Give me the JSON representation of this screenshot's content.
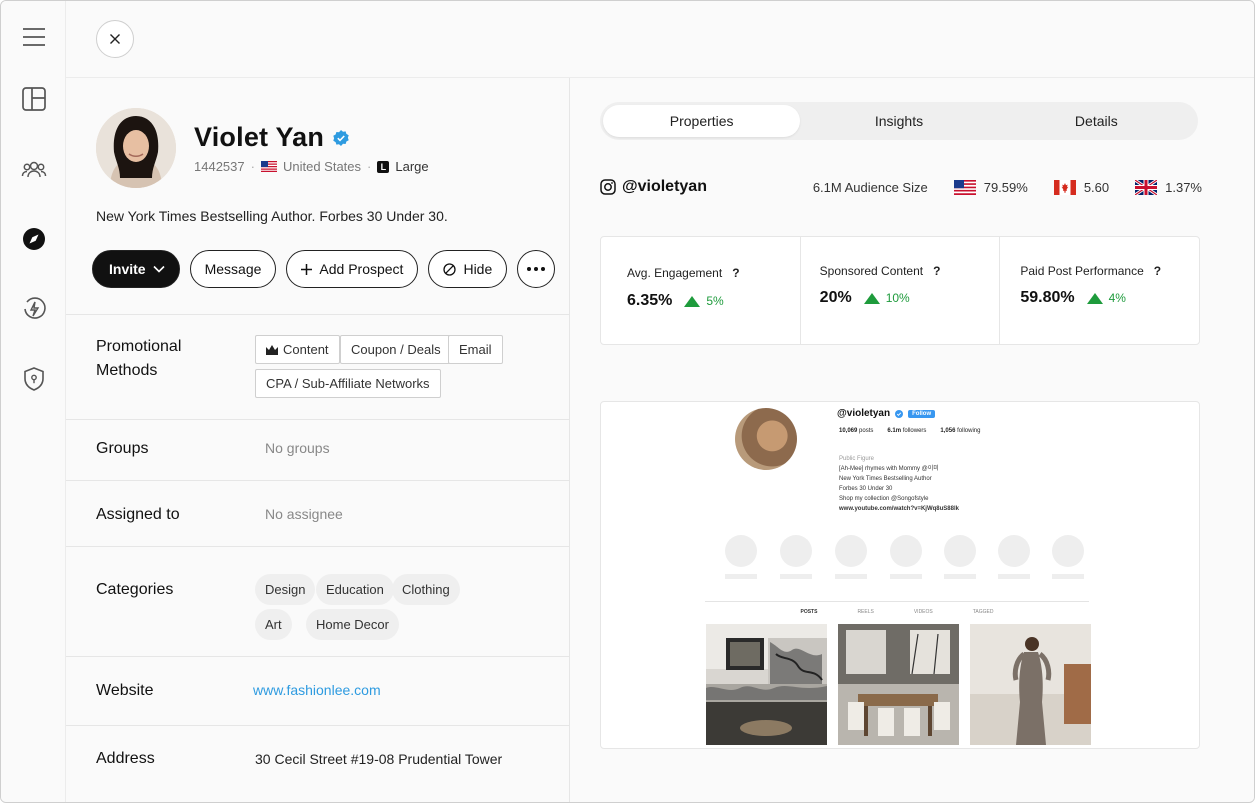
{
  "profile": {
    "name": "Violet Yan",
    "id": "1442537",
    "country": "United States",
    "size": "Large",
    "size_badge": "L",
    "bio": "New York Times Bestselling Author. Forbes 30 Under 30."
  },
  "actions": {
    "invite": "Invite",
    "message": "Message",
    "add_prospect": "Add Prospect",
    "hide": "Hide"
  },
  "sections": {
    "promotional_label_1": "Promotional",
    "promotional_label_2": "Methods",
    "promotional_methods": [
      "Content",
      "Coupon / Deals",
      "Email",
      "CPA / Sub-Affiliate Networks"
    ],
    "groups_label": "Groups",
    "groups_value": "No groups",
    "assigned_label": "Assigned to",
    "assigned_value": "No assignee",
    "categories_label": "Categories",
    "categories": [
      "Design",
      "Education",
      "Clothing",
      "Art",
      "Home Decor"
    ],
    "website_label": "Website",
    "website_value": "www.fashionlee.com",
    "address_label": "Address",
    "address_value": "30 Cecil Street #19-08 Prudential Tower"
  },
  "tabs": [
    "Properties",
    "Insights",
    "Details"
  ],
  "audience": {
    "handle": "@violetyan",
    "size": "6.1M Audience Size",
    "us": "79.59%",
    "ca": "5.60",
    "uk": "1.37%"
  },
  "stats": [
    {
      "title": "Avg. Engagement",
      "value": "6.35%",
      "change": "5%"
    },
    {
      "title": "Sponsored Content",
      "value": "20%",
      "change": "10%"
    },
    {
      "title": "Paid Post Performance",
      "value": "59.80%",
      "change": "4%"
    }
  ],
  "instagram": {
    "handle": "@violetyan",
    "follow": "Follow",
    "posts": "10,069",
    "posts_label": "posts",
    "followers": "6.1m",
    "followers_label": "followers",
    "following": "1,056",
    "following_label": "following",
    "bio_lines": [
      "Public Figure",
      "[Ah-Mee] rhymes with Mommy @이미",
      "New York Times Bestselling Author",
      "Forbes 30 Under 30",
      "Shop my collection @Songofstyle"
    ],
    "link": "www.youtube.com/watch?v=KjWq8uS88lk",
    "tabs": [
      "POSTS",
      "REELS",
      "VIDEOS",
      "TAGGED"
    ]
  },
  "colors": {
    "accent": "#2e9be0",
    "positive": "#1e9b3c",
    "verified": "#2e9be0"
  }
}
